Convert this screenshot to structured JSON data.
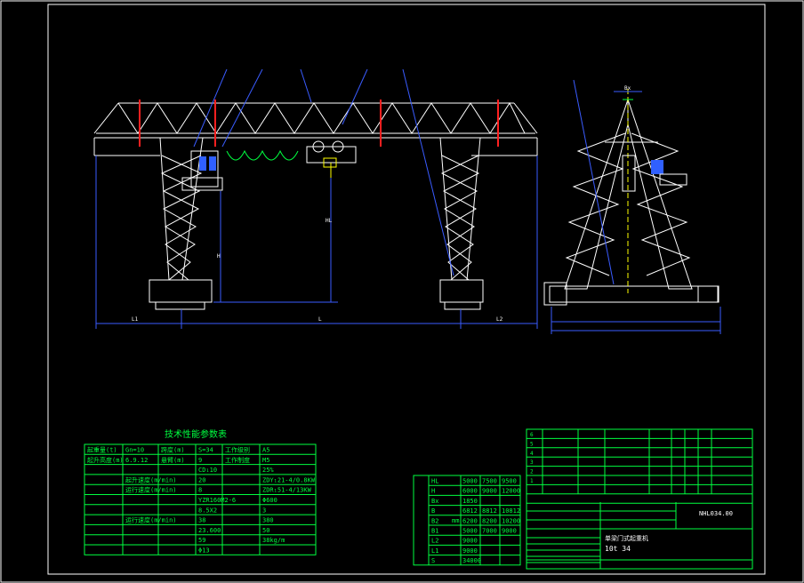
{
  "colors": {
    "background": "#000000",
    "frame": "#ffffff",
    "structure": "#ffffff",
    "table": "#00ff40",
    "dimension": "#3a5cff",
    "accent_red": "#ff2020",
    "accent_yellow": "#ffff00",
    "accent_magenta": "#ff40ff",
    "cabin": "#3060ff"
  },
  "front_view_dims": {
    "l1": "L1",
    "l": "L",
    "l2": "L2",
    "h": "H",
    "hl": "HL"
  },
  "side_view_dims": {
    "bx": "Bx"
  },
  "param_table": {
    "title": "技术性能参数表",
    "rows": [
      [
        "起重量(t)",
        "Gn=10",
        "跨度(m)",
        "S=34",
        "工作级别",
        "A5"
      ],
      [
        "起升高度(m)",
        "6.9.12",
        "悬臂(m)",
        "9",
        "工作制度",
        "M5"
      ],
      [
        "",
        "",
        "",
        "CD₁10",
        "",
        "25%"
      ],
      [
        "",
        "起升速度(m/min)",
        "",
        "20",
        "",
        "ZDY₁21-4/0.8KW"
      ],
      [
        "",
        "运行速度(m/min)",
        "",
        "8",
        "",
        "ZDR₁51-4/13KW"
      ],
      [
        "",
        "",
        "",
        "YZR160M2-6",
        "",
        "Φ600"
      ],
      [
        "",
        "",
        "",
        "8.5X2",
        "",
        "3"
      ],
      [
        "",
        "运行速度(m/min)",
        "",
        "38",
        "",
        "380"
      ],
      [
        "",
        "",
        "",
        "23.600",
        "",
        "50"
      ],
      [
        "",
        "",
        "",
        "59",
        "",
        "38kg/m"
      ],
      [
        "",
        "",
        "",
        "Φ13",
        "",
        ""
      ]
    ]
  },
  "dim_table": {
    "unit": "mm",
    "rows": [
      [
        "HL",
        "5000",
        "7500",
        "9500"
      ],
      [
        "H",
        "6000",
        "9000",
        "12000"
      ],
      [
        "Bx",
        "1850",
        "",
        ""
      ],
      [
        "B",
        "6812",
        "8812",
        "10812"
      ],
      [
        "B2",
        "6200",
        "8200",
        "10200"
      ],
      [
        "B1",
        "5000",
        "7000",
        "9000"
      ],
      [
        "L2",
        "9000",
        "",
        ""
      ],
      [
        "L1",
        "9000",
        "",
        ""
      ],
      [
        "S",
        "34000",
        "",
        ""
      ]
    ]
  },
  "parts_list": {
    "rows": [
      "6",
      "5",
      "4",
      "3",
      "2",
      "1"
    ]
  },
  "title_block": {
    "drawing_no": "NHL034.00",
    "product": "单梁门式起重机",
    "spec": "10t  34"
  }
}
